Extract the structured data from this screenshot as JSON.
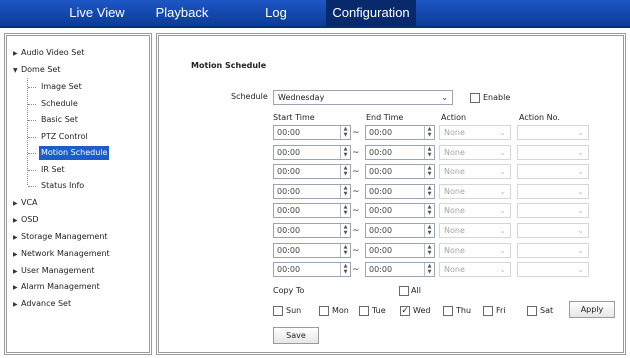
{
  "nav": {
    "tabs": [
      "Live View",
      "Playback",
      "Log",
      "Configuration"
    ],
    "active_tab": "Configuration"
  },
  "sidebar": {
    "items": [
      {
        "label": "Audio Video Set",
        "expanded": false
      },
      {
        "label": "Dome Set",
        "expanded": true,
        "children": [
          "Image Set",
          "Schedule",
          "Basic Set",
          "PTZ Control",
          "Motion Schedule",
          "IR Set",
          "Status Info"
        ],
        "active_child": "Motion Schedule"
      },
      {
        "label": "VCA",
        "expanded": false
      },
      {
        "label": "OSD",
        "expanded": false
      },
      {
        "label": "Storage Management",
        "expanded": false
      },
      {
        "label": "Network Management",
        "expanded": false
      },
      {
        "label": "User Management",
        "expanded": false
      },
      {
        "label": "Alarm Management",
        "expanded": false
      },
      {
        "label": "Advance Set",
        "expanded": false
      }
    ]
  },
  "main": {
    "title": "Motion Schedule",
    "schedule_label": "Schedule",
    "schedule_value": "Wednesday",
    "enable_label": "Enable",
    "enable_checked": false,
    "columns": {
      "start": "Start Time",
      "end": "End Time",
      "action": "Action",
      "action_no": "Action No."
    },
    "tilde": "~",
    "rows": [
      {
        "start": "00:00",
        "end": "00:00",
        "action": "None",
        "action_no": ""
      },
      {
        "start": "00:00",
        "end": "00:00",
        "action": "None",
        "action_no": ""
      },
      {
        "start": "00:00",
        "end": "00:00",
        "action": "None",
        "action_no": ""
      },
      {
        "start": "00:00",
        "end": "00:00",
        "action": "None",
        "action_no": ""
      },
      {
        "start": "00:00",
        "end": "00:00",
        "action": "None",
        "action_no": ""
      },
      {
        "start": "00:00",
        "end": "00:00",
        "action": "None",
        "action_no": ""
      },
      {
        "start": "00:00",
        "end": "00:00",
        "action": "None",
        "action_no": ""
      },
      {
        "start": "00:00",
        "end": "00:00",
        "action": "None",
        "action_no": ""
      }
    ],
    "copy_to_label": "Copy To",
    "all_label": "All",
    "all_checked": false,
    "days": [
      {
        "label": "Sun",
        "checked": false
      },
      {
        "label": "Mon",
        "checked": false
      },
      {
        "label": "Tue",
        "checked": false
      },
      {
        "label": "Wed",
        "checked": true
      },
      {
        "label": "Thu",
        "checked": false
      },
      {
        "label": "Fri",
        "checked": false
      },
      {
        "label": "Sat",
        "checked": false
      }
    ],
    "apply_label": "Apply",
    "save_label": "Save"
  },
  "icons": {
    "collapsed": "triangle-right-icon",
    "expanded": "triangle-down-icon",
    "dropdown": "chevron-down-icon",
    "spinner": "up-down-spinner-icon"
  },
  "colors": {
    "nav_bg": "#0c3c98",
    "active_tab": "#082a6d",
    "active_item": "#1c5dc7"
  }
}
